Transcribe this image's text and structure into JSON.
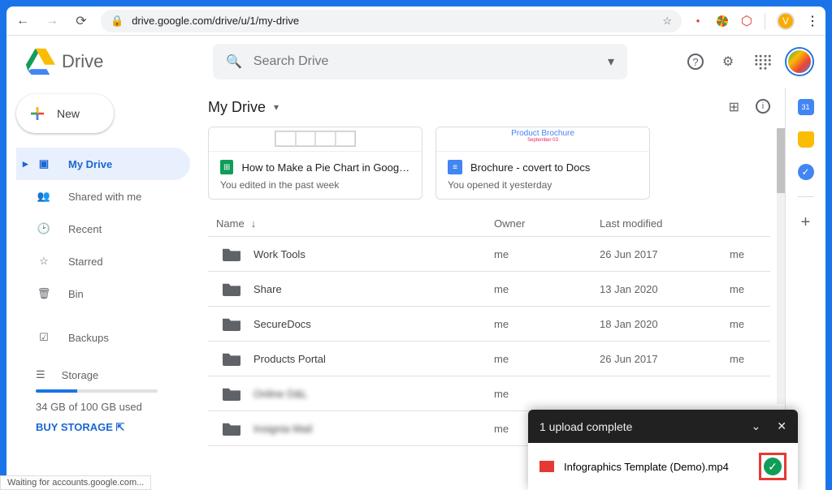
{
  "url": "drive.google.com/drive/u/1/my-drive",
  "avatar_letter": "V",
  "drive_title": "Drive",
  "search_placeholder": "Search Drive",
  "new_label": "New",
  "sidebar": [
    {
      "name": "my-drive",
      "label": "My Drive",
      "active": true
    },
    {
      "name": "shared",
      "label": "Shared with me"
    },
    {
      "name": "recent",
      "label": "Recent"
    },
    {
      "name": "starred",
      "label": "Starred"
    },
    {
      "name": "bin",
      "label": "Bin"
    },
    {
      "name": "backups",
      "label": "Backups"
    }
  ],
  "storage_label": "Storage",
  "storage_used": "34 GB of 100 GB used",
  "buy_storage": "BUY STORAGE",
  "breadcrumb": "My Drive",
  "cards": [
    {
      "title": "How to Make a Pie Chart in Google S...",
      "sub": "You edited in the past week",
      "iconColor": "#0f9d58",
      "type": "sheets",
      "preview_text": ""
    },
    {
      "title": "Brochure - covert to Docs",
      "sub": "You opened it yesterday",
      "iconColor": "#4285f4",
      "type": "docs",
      "preview_text": "Product Brochure"
    }
  ],
  "columns": {
    "name": "Name",
    "owner": "Owner",
    "modified": "Last modified"
  },
  "rows": [
    {
      "name": "Work Tools",
      "owner": "me",
      "modified": "26 Jun 2017",
      "mod_owner": "me",
      "blur": false
    },
    {
      "name": "Share",
      "owner": "me",
      "modified": "13 Jan 2020",
      "mod_owner": "me",
      "blur": false
    },
    {
      "name": "SecureDocs",
      "owner": "me",
      "modified": "18 Jan 2020",
      "mod_owner": "me",
      "blur": false
    },
    {
      "name": "Products Portal",
      "owner": "me",
      "modified": "26 Jun 2017",
      "mod_owner": "me",
      "blur": false
    },
    {
      "name": "Online D&L",
      "owner": "me",
      "modified": "",
      "mod_owner": "",
      "blur": true
    },
    {
      "name": "Insignia Mail",
      "owner": "me",
      "modified": "",
      "mod_owner": "",
      "blur": true
    }
  ],
  "toast": {
    "title": "1 upload complete",
    "filename": "Infographics Template (Demo).mp4"
  },
  "status_text": "Waiting for accounts.google.com..."
}
